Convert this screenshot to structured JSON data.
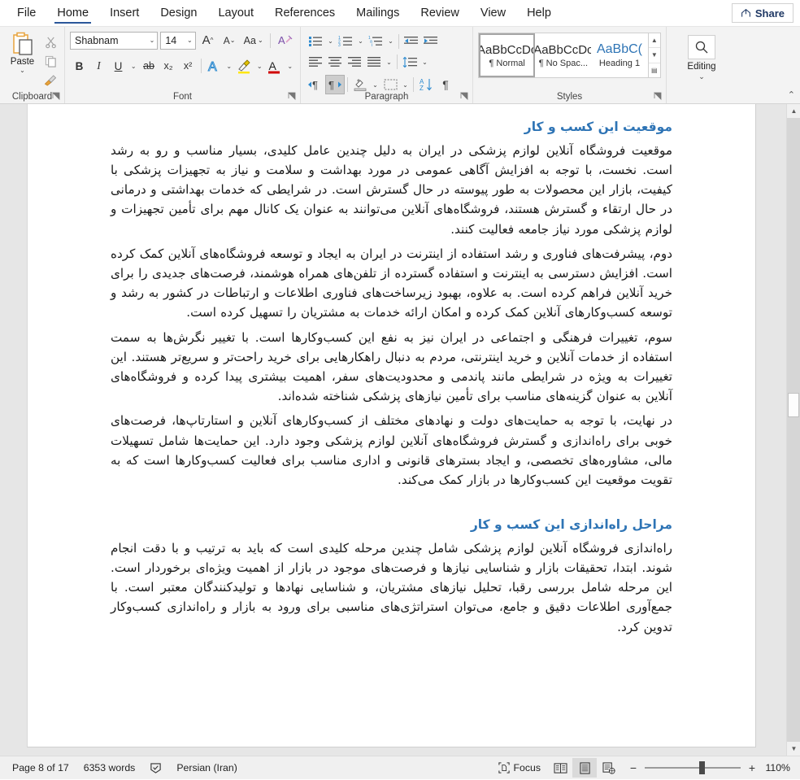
{
  "ribbon": {
    "tabs": [
      {
        "label": "File",
        "active": false
      },
      {
        "label": "Home",
        "active": true
      },
      {
        "label": "Insert",
        "active": false
      },
      {
        "label": "Design",
        "active": false
      },
      {
        "label": "Layout",
        "active": false
      },
      {
        "label": "References",
        "active": false
      },
      {
        "label": "Mailings",
        "active": false
      },
      {
        "label": "Review",
        "active": false
      },
      {
        "label": "View",
        "active": false
      },
      {
        "label": "Help",
        "active": false
      }
    ],
    "share_label": "Share",
    "groups": {
      "clipboard": {
        "label": "Clipboard",
        "paste_label": "Paste",
        "cut_icon": "scissors-icon",
        "copy_icon": "copy-icon",
        "format_painter_icon": "format-painter-icon"
      },
      "font": {
        "label": "Font",
        "font_name": "Shabnam",
        "font_size": "14",
        "grow_font_icon": "grow-font-icon",
        "shrink_font_icon": "shrink-font-icon",
        "change_case_icon": "change-case-icon",
        "clear_formatting_icon": "clear-formatting-icon",
        "bold": "B",
        "italic": "I",
        "underline": "U",
        "strikethrough": "ab",
        "subscript": "x₂",
        "superscript": "x²",
        "text_effects_icon": "text-effects-icon",
        "highlight_icon": "text-highlight-icon",
        "font_color_icon": "font-color-icon"
      },
      "paragraph": {
        "label": "Paragraph",
        "bullets_icon": "bullet-list-icon",
        "numbering_icon": "numbered-list-icon",
        "multilevel_icon": "multilevel-list-icon",
        "decrease_indent_icon": "decrease-indent-icon",
        "increase_indent_icon": "increase-indent-icon",
        "align_left_icon": "align-left-icon",
        "align_center_icon": "align-center-icon",
        "align_right_icon": "align-right-icon",
        "justify_icon": "justify-icon",
        "line_spacing_icon": "line-spacing-icon",
        "ltr_icon": "left-to-right-icon",
        "rtl_icon": "right-to-left-icon",
        "shading_icon": "shading-icon",
        "borders_icon": "borders-icon",
        "sort_icon": "sort-icon",
        "show_marks_icon": "show-formatting-marks-icon"
      },
      "styles": {
        "label": "Styles",
        "items": [
          {
            "sample": "AaBbCcDc",
            "name": "¶ Normal",
            "selected": true,
            "heading": false
          },
          {
            "sample": "AaBbCcDc",
            "name": "¶ No Spac...",
            "selected": false,
            "heading": false
          },
          {
            "sample": "AaBbC(",
            "name": "Heading 1",
            "selected": false,
            "heading": true
          }
        ]
      },
      "editing": {
        "label": "Editing",
        "icon": "search-icon"
      }
    },
    "collapse_icon": "collapse-ribbon-icon"
  },
  "document": {
    "sections": [
      {
        "heading": "موقعیت این کسب و کار",
        "paragraphs": [
          "موقعیت فروشگاه آنلاین لوازم پزشکی در ایران به دلیل چندین عامل کلیدی، بسیار مناسب و رو به رشد است. نخست، با توجه به افزایش آگاهی عمومی در مورد بهداشت و سلامت و نیاز به تجهیزات پزشکی با کیفیت، بازار این محصولات به طور پیوسته در حال گسترش است. در شرایطی که خدمات بهداشتی و درمانی در حال ارتقاء و گسترش هستند، فروشگاه‌های آنلاین می‌توانند به عنوان یک کانال مهم برای تأمین تجهیزات و لوازم پزشکی مورد نیاز جامعه فعالیت کنند.",
          "دوم، پیشرفت‌های فناوری و رشد استفاده از اینترنت در ایران به ایجاد و توسعه فروشگاه‌های آنلاین کمک کرده است. افزایش دسترسی به اینترنت و استفاده گسترده از تلفن‌های همراه هوشمند، فرصت‌های جدیدی را برای خرید آنلاین فراهم کرده است. به علاوه، بهبود زیرساخت‌های فناوری اطلاعات و ارتباطات در کشور به رشد و توسعه کسب‌وکارهای آنلاین کمک کرده و امکان ارائه خدمات به مشتریان را تسهیل کرده است.",
          "سوم، تغییرات فرهنگی و اجتماعی در ایران نیز به نفع این کسب‌وکارها است. با تغییر نگرش‌ها به سمت استفاده از خدمات آنلاین و خرید اینترنتی، مردم به دنبال راهکارهایی برای خرید راحت‌تر و سریع‌تر هستند. این تغییرات به ویژه در شرایطی مانند پاندمی و محدودیت‌های سفر، اهمیت بیشتری پیدا کرده و فروشگاه‌های آنلاین به عنوان گزینه‌های مناسب برای تأمین نیازهای پزشکی شناخته شده‌اند.",
          "در نهایت، با توجه به حمایت‌های دولت و نهادهای مختلف از کسب‌وکارهای آنلاین و استارتاپ‌ها، فرصت‌های خوبی برای راه‌اندازی و گسترش فروشگاه‌های آنلاین لوازم پزشکی وجود دارد. این حمایت‌ها شامل تسهیلات مالی، مشاوره‌های تخصصی، و ایجاد بسترهای قانونی و اداری مناسب برای فعالیت کسب‌وکارها است که به تقویت موقعیت این کسب‌وکارها در بازار کمک می‌کند."
        ]
      },
      {
        "heading": "مراحل راه‌اندازی این کسب و کار",
        "paragraphs": [
          "راه‌اندازی فروشگاه آنلاین لوازم پزشکی شامل چندین مرحله کلیدی است که باید به ترتیب و با دقت انجام شوند. ابتدا، تحقیقات بازار و شناسایی نیازها و فرصت‌های موجود در بازار از اهمیت ویژه‌ای برخوردار است. این مرحله شامل بررسی رقبا، تحلیل نیازهای مشتریان، و شناسایی نهادها و تولیدکنندگان معتبر است. با جمع‌آوری اطلاعات دقیق و جامع، می‌توان استراتژی‌های مناسبی برای ورود به بازار و راه‌اندازی کسب‌وکار تدوین کرد."
        ]
      }
    ],
    "heading_color": "#2e74b5"
  },
  "scrollbar": {
    "up_icon": "scroll-up-icon",
    "down_icon": "scroll-down-icon"
  },
  "statusbar": {
    "page_info": "Page 8 of 17",
    "word_count": "6353 words",
    "proofing_icon": "proofing-errors-icon",
    "language": "Persian (Iran)",
    "focus_label": "Focus",
    "focus_icon": "focus-mode-icon",
    "read_mode_icon": "read-mode-icon",
    "print_layout_icon": "print-layout-icon",
    "web_layout_icon": "web-layout-icon",
    "zoom_out_label": "−",
    "zoom_in_label": "+",
    "zoom_level": "110%"
  }
}
